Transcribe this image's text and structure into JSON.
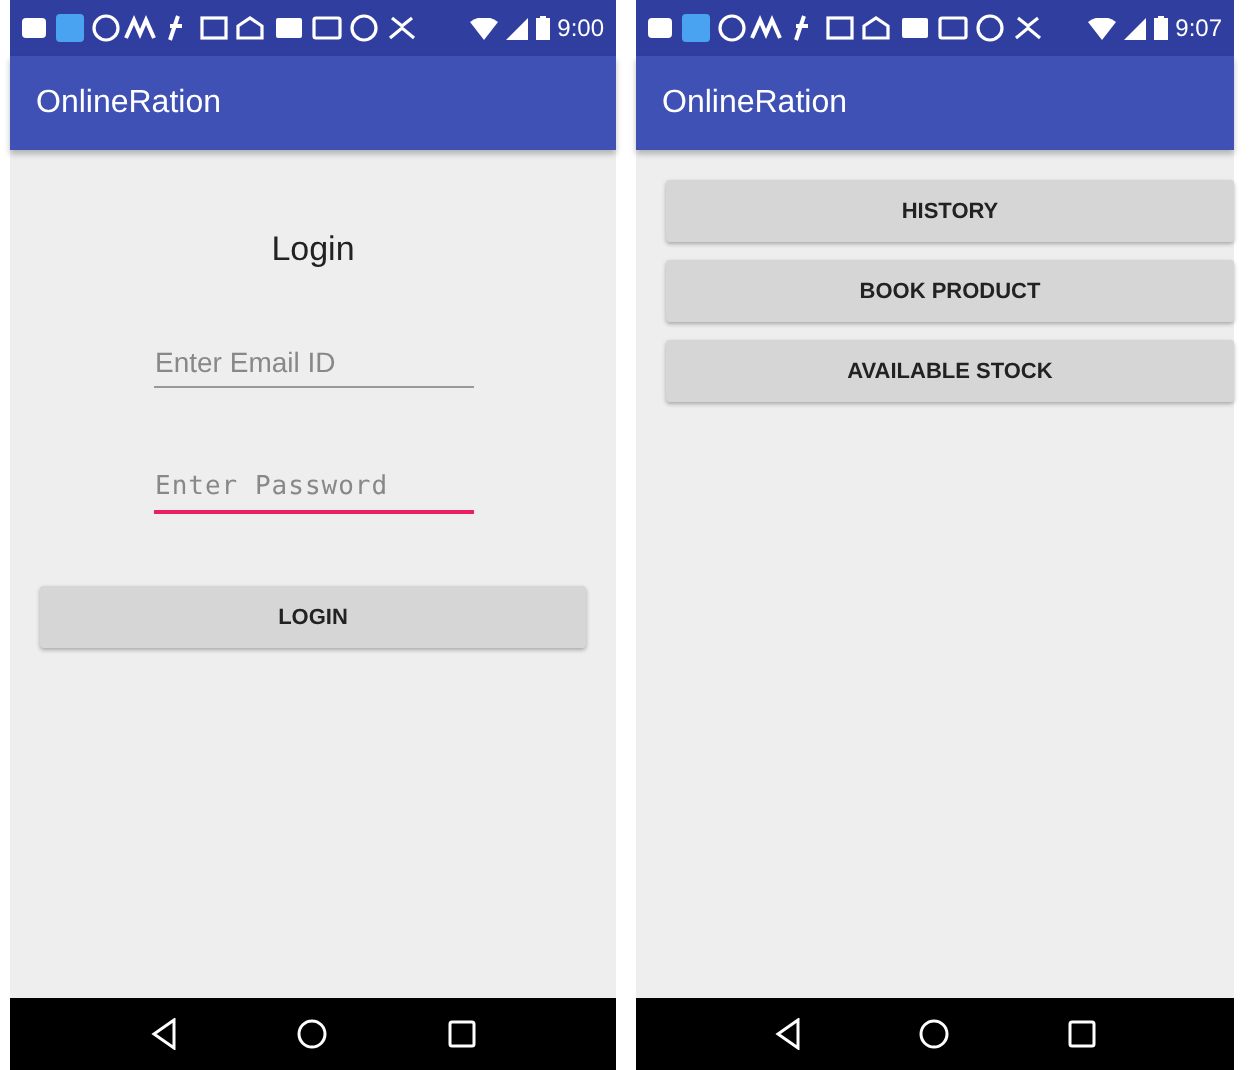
{
  "screens": [
    {
      "kind": "login",
      "status_bar": {
        "time": "9:00"
      },
      "app_bar": {
        "title": "OnlineRation"
      },
      "heading": "Login",
      "fields": [
        {
          "kind": "email",
          "placeholder": "Enter Email ID",
          "focused": false
        },
        {
          "kind": "password",
          "placeholder": "Enter Password",
          "focused": true
        }
      ],
      "button": "LOGIN"
    },
    {
      "kind": "menu",
      "status_bar": {
        "time": "9:07"
      },
      "app_bar": {
        "title": "OnlineRation"
      },
      "buttons": [
        "HISTORY",
        "BOOK PRODUCT",
        "AVAILABLE STOCK"
      ]
    }
  ]
}
